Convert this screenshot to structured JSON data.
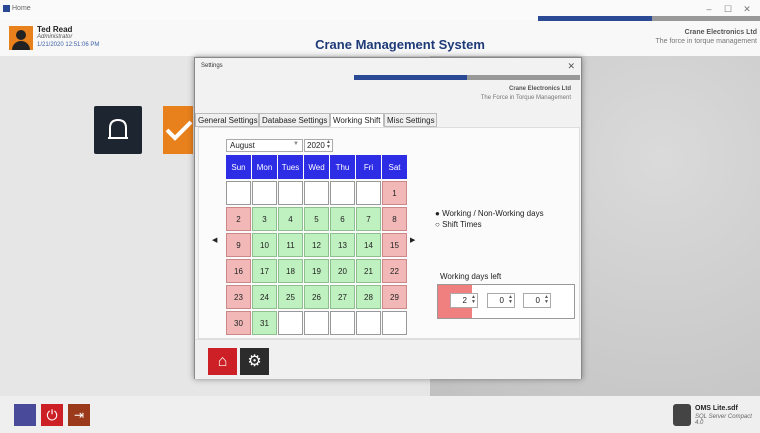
{
  "window": {
    "title": "Home"
  },
  "header": {
    "username": "Ted Read",
    "role": "Administrator",
    "datetime": "1/21/2020 12:51:06 PM",
    "system_title": "Crane Management System",
    "company": "Crane Electronics Ltd",
    "tagline": "The force in torque management"
  },
  "dialog": {
    "title": "Settings",
    "company": "Crane Electronics Ltd",
    "tagline": "The Force in Torque Management",
    "tabs": [
      "General Settings",
      "Database Settings",
      "Working Shift",
      "Misc Settings"
    ],
    "active_tab": "Working Shift",
    "month": "August",
    "year": "2020",
    "weekdays": [
      "Sun",
      "Mon",
      "Tues",
      "Wed",
      "Thu",
      "Fri",
      "Sat"
    ],
    "weeks": [
      [
        "",
        "",
        "",
        "",
        "",
        "",
        "1"
      ],
      [
        "2",
        "3",
        "4",
        "5",
        "6",
        "7",
        "8"
      ],
      [
        "9",
        "10",
        "11",
        "12",
        "13",
        "14",
        "15"
      ],
      [
        "16",
        "17",
        "18",
        "19",
        "20",
        "21",
        "22"
      ],
      [
        "23",
        "24",
        "25",
        "26",
        "27",
        "28",
        "29"
      ],
      [
        "30",
        "31",
        "",
        "",
        "",
        "",
        ""
      ]
    ],
    "nav_prev": "◀",
    "nav_next": "▶",
    "radio_working": "Working / Non-Working days",
    "radio_shift": "Shift Times",
    "selected_radio": "Working / Non-Working days",
    "working_days_label": "Working days left",
    "working_days_values": [
      "2",
      "0",
      "0"
    ]
  },
  "footer": {
    "db_name": "OMS Lite.sdf",
    "db_type": "SQL Server Compact 4.0"
  },
  "colors": {
    "accent_blue": "#2a4a96",
    "header_blue": "#2d2de6",
    "work_green": "#bff0bf",
    "off_red": "#f2b8b8",
    "brand_orange": "#e8801c",
    "button_red": "#cc2026"
  }
}
